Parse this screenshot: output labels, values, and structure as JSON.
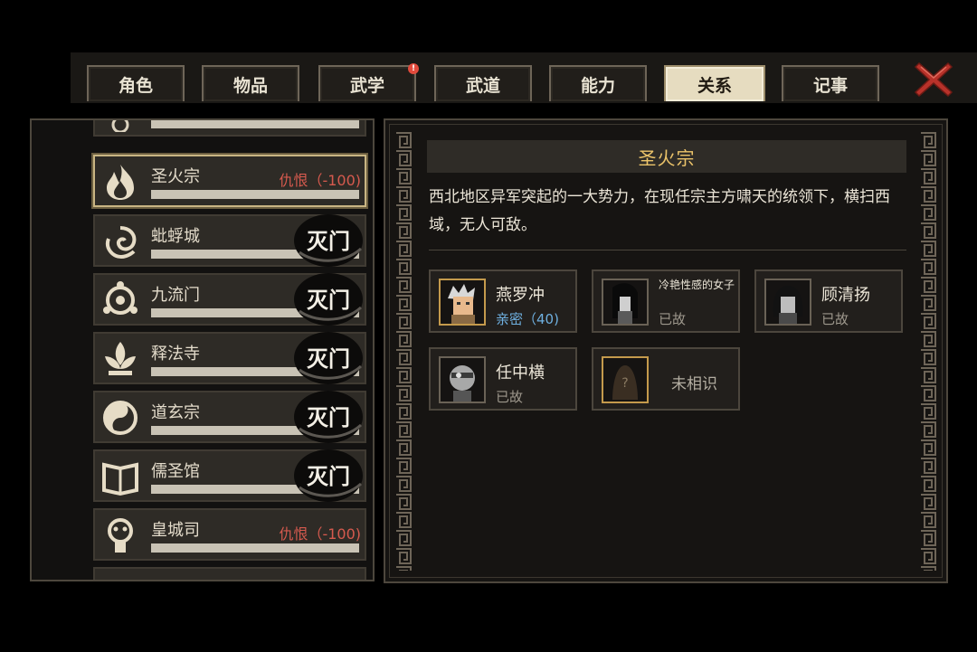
{
  "tabs": [
    {
      "label": "角色",
      "active": false
    },
    {
      "label": "物品",
      "active": false
    },
    {
      "label": "武学",
      "active": false,
      "badge": "!"
    },
    {
      "label": "武道",
      "active": false
    },
    {
      "label": "能力",
      "active": false
    },
    {
      "label": "关系",
      "active": true
    },
    {
      "label": "记事",
      "active": false
    }
  ],
  "sects": [
    {
      "name": "圣火宗",
      "relation": "仇恨（-100)",
      "selected": true,
      "destroyed": false
    },
    {
      "name": "蚍蜉城",
      "relation": "",
      "selected": false,
      "destroyed": true
    },
    {
      "name": "九流门",
      "relation": "",
      "selected": false,
      "destroyed": true
    },
    {
      "name": "释法寺",
      "relation": "",
      "selected": false,
      "destroyed": true
    },
    {
      "name": "道玄宗",
      "relation": "",
      "selected": false,
      "destroyed": true
    },
    {
      "name": "儒圣馆",
      "relation": "",
      "selected": false,
      "destroyed": true
    },
    {
      "name": "皇城司",
      "relation": "仇恨（-100)",
      "selected": false,
      "destroyed": false
    }
  ],
  "seal_text": "灭门",
  "detail": {
    "title": "圣火宗",
    "description": "西北地区异军突起的一大势力，在现任宗主方啸天的统领下，横扫西域，无人可敌。"
  },
  "members": [
    {
      "name": "燕罗冲",
      "status": "亲密（40)",
      "status_color": "#6fb0e0"
    },
    {
      "name": "冷艳性感的女子",
      "status": "已故"
    },
    {
      "name": "顾清扬",
      "status": "已故"
    },
    {
      "name": "任中横",
      "status": "已故"
    },
    {
      "name": "未相识",
      "unknown_mark": "?"
    }
  ],
  "colors": {
    "accent_gold": "#ecc46a",
    "hostile_red": "#d65a4e",
    "friendly_blue": "#6fb0e0"
  }
}
